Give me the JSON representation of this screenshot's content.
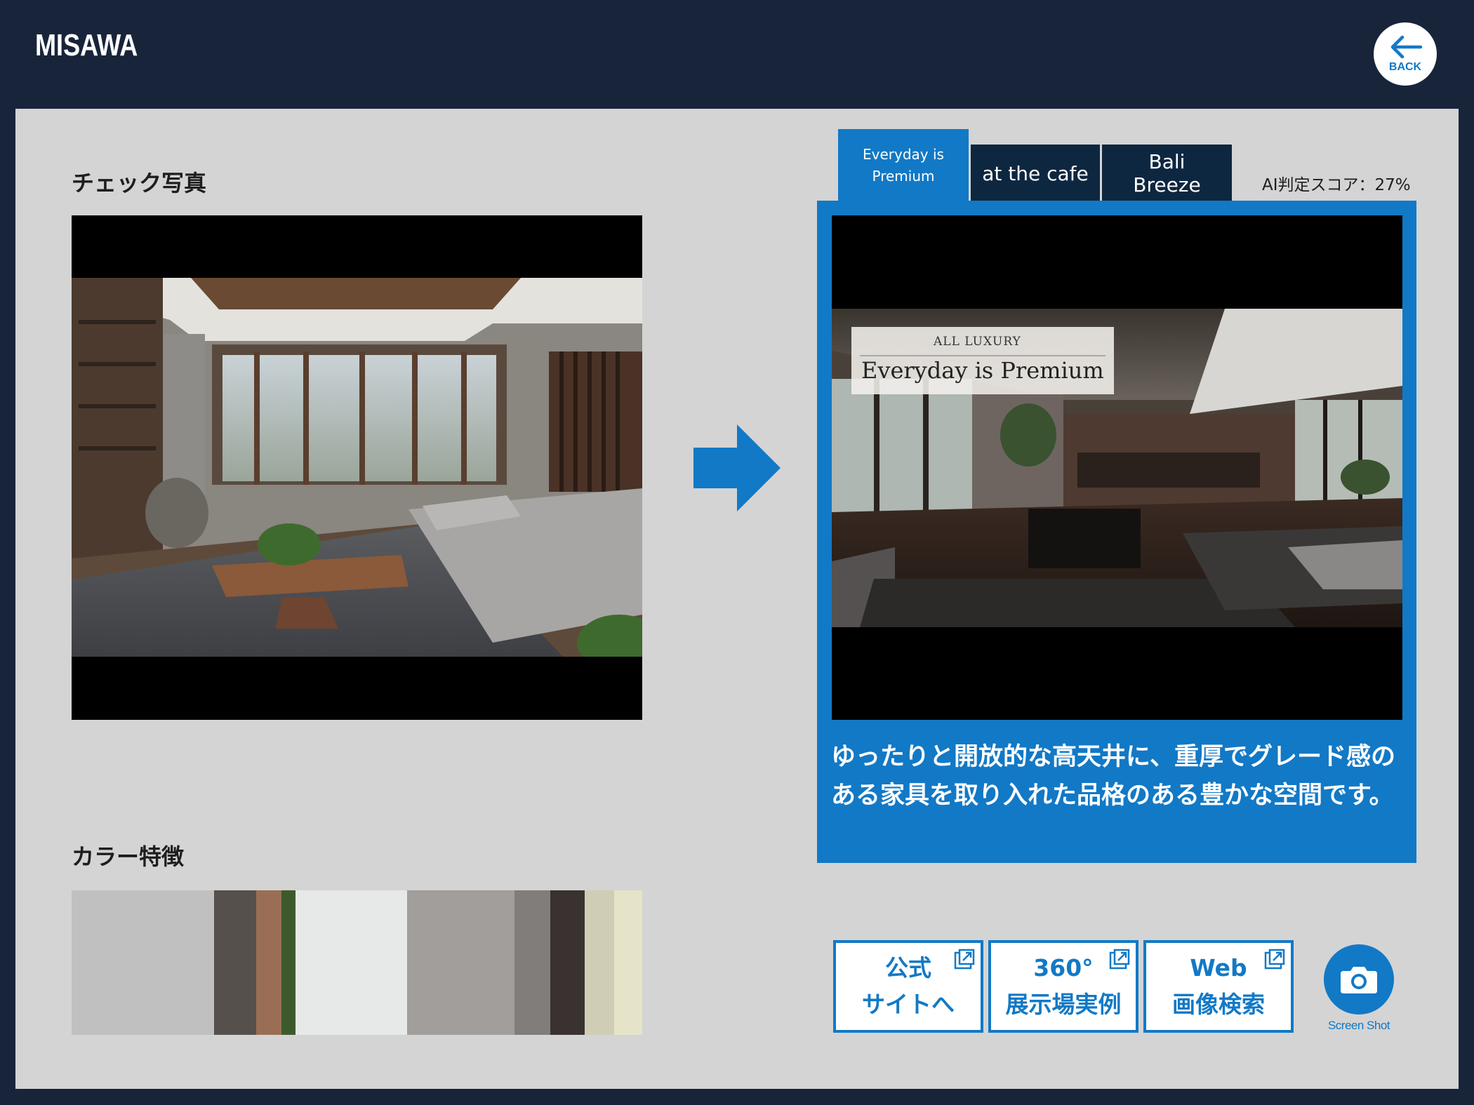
{
  "header": {
    "logo": "MISAWA",
    "back_label": "BACK",
    "back_icon": "arrow-left-icon"
  },
  "left": {
    "photo_title": "チェック写真",
    "color_title": "カラー特徴",
    "palette": [
      "#c0c0c0",
      "#55504c",
      "#9a6e55",
      "#3d5a2c",
      "#e6e9e8",
      "#a19e9b",
      "#807d7a",
      "#3a3230",
      "#cfcdb6",
      "#e6e4c8"
    ]
  },
  "result": {
    "tabs": [
      {
        "label": "Everyday is Premium",
        "active": true
      },
      {
        "label": "at the cafe",
        "active": false
      },
      {
        "label": "Bali Breeze",
        "active": false
      }
    ],
    "score_label": "AI判定スコア：27%",
    "overlay_small": "ALL LUXURY",
    "overlay_title": "Everyday is Premium",
    "description": "ゆったりと開放的な高天井に、重厚でグレード感のある家具を取り入れた品格のある豊かな空間です。"
  },
  "actions": {
    "official_line1": "公式",
    "official_line2": "サイトへ",
    "showroom_line1": "360°",
    "showroom_line2": "展示場実例",
    "web_line1": "Web",
    "web_line2": "画像検索",
    "screenshot_label": "Screen Shot",
    "external_icon": "external-link-icon",
    "camera_icon": "camera-icon"
  },
  "colors": {
    "background": "#18243a",
    "panel": "#d4d4d4",
    "accent": "#1279c6",
    "tab_inactive": "#0e2740"
  }
}
